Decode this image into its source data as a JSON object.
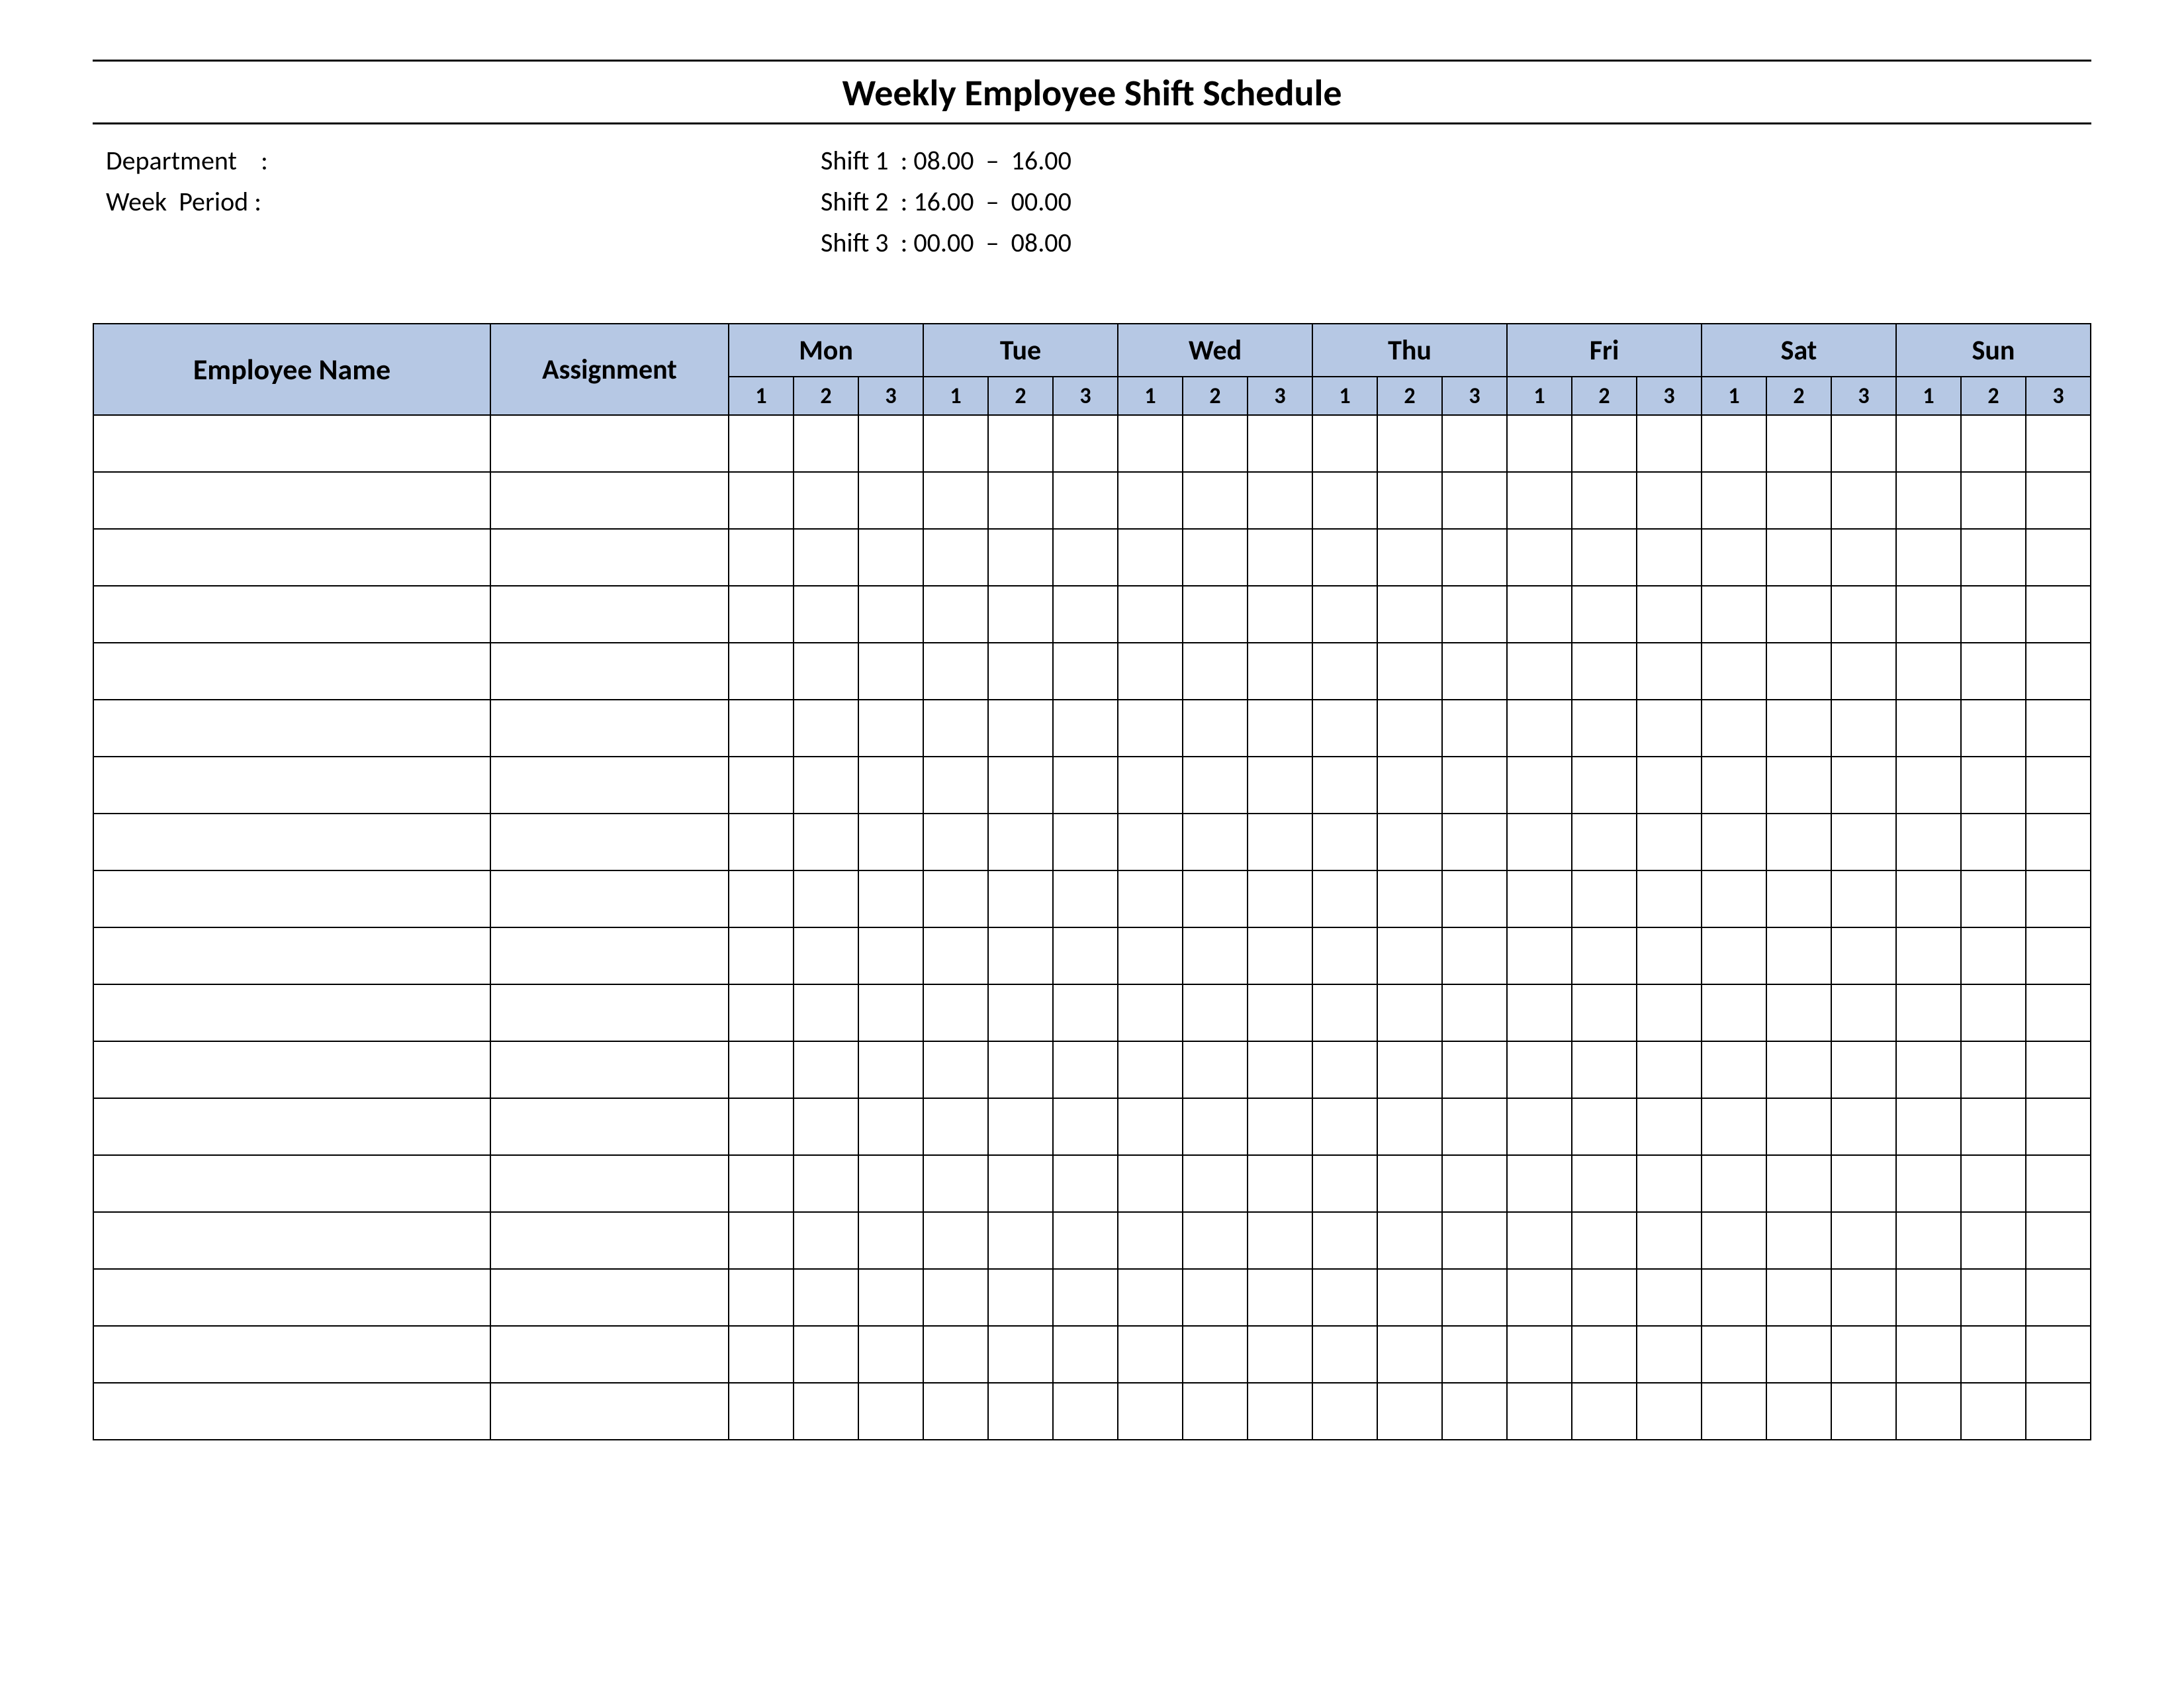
{
  "title": "Weekly Employee Shift Schedule",
  "meta": {
    "department_label": "Department    :",
    "department_value": "",
    "week_period_label": "Week  Period :",
    "week_period_value": "",
    "shifts": [
      {
        "label": "Shift 1  :",
        "value": "08.00  –  16.00"
      },
      {
        "label": "Shift 2  :",
        "value": "16.00  –  00.00"
      },
      {
        "label": "Shift 3  :",
        "value": "00.00  –  08.00"
      }
    ]
  },
  "table": {
    "employee_header": "Employee Name",
    "assignment_header": "Assignment",
    "days": [
      "Mon",
      "Tue",
      "Wed",
      "Thu",
      "Fri",
      "Sat",
      "Sun"
    ],
    "shift_numbers": [
      "1",
      "2",
      "3"
    ],
    "body_row_count": 18
  }
}
